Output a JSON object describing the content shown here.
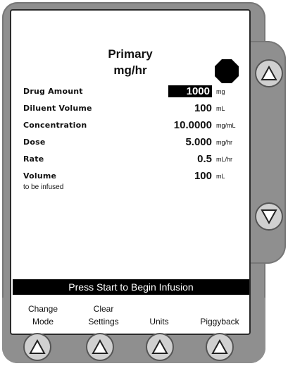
{
  "header": {
    "mode": "Primary",
    "units": "mg/hr"
  },
  "fields": [
    {
      "label": "Drug Amount",
      "value": "1000",
      "unit": "mg"
    },
    {
      "label": "Diluent Volume",
      "value": "100",
      "unit": "mL"
    },
    {
      "label": "Concentration",
      "value": "10.0000",
      "unit": "mg/mL"
    },
    {
      "label": "Dose",
      "value": "5.000",
      "unit": "mg/hr"
    },
    {
      "label": "Rate",
      "value": "0.5",
      "unit": "mL/hr"
    },
    {
      "label": "Volume",
      "sublabel": "to be infused",
      "value": "100",
      "unit": "mL"
    }
  ],
  "status": "Press Start to Begin Infusion",
  "softkeys": [
    {
      "line1": "Change",
      "line2": "Mode"
    },
    {
      "line1": "Clear",
      "line2": "Settings"
    },
    {
      "line1": "",
      "line2": "Units"
    },
    {
      "line1": "",
      "line2": "Piggyback"
    }
  ],
  "icons": {
    "stop": "stop-octagon-icon",
    "scroll_up": "arrow-up-icon",
    "scroll_down": "arrow-down-icon",
    "softkey": "arrow-up-icon"
  },
  "colors": {
    "frame": "#8f8f8f",
    "screen": "#ffffff",
    "status_bar": "#000000",
    "highlight": "#000000"
  }
}
